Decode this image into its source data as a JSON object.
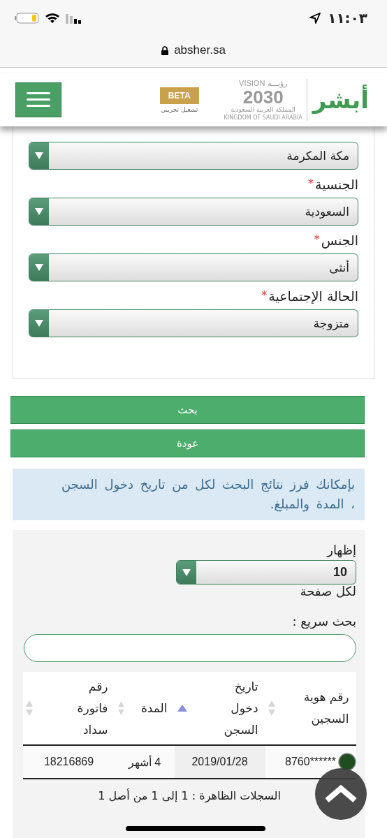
{
  "status_bar": {
    "time": "١١:٠٣"
  },
  "browser": {
    "url": "absher.sa"
  },
  "header": {
    "brand": "أبشر",
    "vision_word": "VISION",
    "vision_arabic": "رؤيـــة",
    "vision_year": "2030",
    "kingdom_ar": "المملكة العربية السعودية",
    "kingdom_en": "KINGDOM OF SAUDI ARABIA",
    "beta": "BETA",
    "beta_sub": "تشغيل تجريبي"
  },
  "form": {
    "fields": [
      {
        "value": "مكة المكرمة"
      },
      {
        "label": "الجنسية",
        "required_mark": "*",
        "value": "السعودية"
      },
      {
        "label": "الجنس",
        "required_mark": "*",
        "value": "أنثى"
      },
      {
        "label": "الحالة الإجتماعية",
        "required_mark": "*",
        "value": "متزوجة"
      }
    ]
  },
  "buttons": [
    "بحث",
    "عودة"
  ],
  "info": "بإمكانك فرز نتائج البحث لكل من تاريخ دخول السجن ، المدة والمبلغ.",
  "results": {
    "show_label": "إظهار",
    "page_size": "10",
    "per_page_label": "لكل صفحة",
    "search_label": "بحث سريع :",
    "columns": [
      {
        "label": "رقم هوية السجين",
        "sorted": false
      },
      {
        "label": "تاريخ دخول السجن",
        "sorted": true
      },
      {
        "label": "المدة",
        "sorted": false
      },
      {
        "label": "رقم فاتورة سداد",
        "sorted": false
      }
    ],
    "rows": [
      [
        "******8760",
        "2019/01/28",
        "4 أشهر",
        "18216869"
      ]
    ],
    "summary": "السجلات الظاهرة : 1 إلى 1 من أصل 1"
  }
}
